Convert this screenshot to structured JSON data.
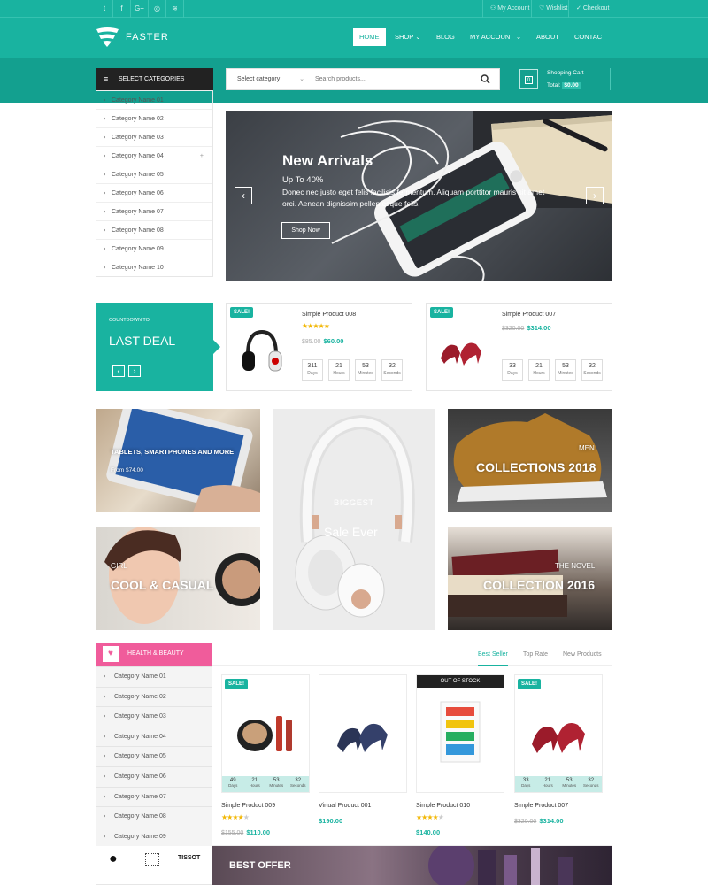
{
  "topbar": {
    "social": [
      "twitter-icon",
      "facebook-icon",
      "google-plus-icon",
      "instagram-icon",
      "rss-icon"
    ],
    "social_glyphs": [
      "t",
      "f",
      "G+",
      "◎",
      "≋"
    ],
    "my_account": "My Account",
    "wishlist": "Wishlist",
    "checkout": "Checkout"
  },
  "header": {
    "brand": "FASTER",
    "nav": [
      "HOME",
      "SHOP",
      "BLOG",
      "MY ACCOUNT",
      "ABOUT",
      "CONTACT"
    ]
  },
  "categories": {
    "title": "SELECT CATEGORIES",
    "items": [
      "Category Name 01",
      "Category Name 02",
      "Category Name 03",
      "Category Name 04",
      "Category Name 05",
      "Category Name 06",
      "Category Name 07",
      "Category Name 08",
      "Category Name 09",
      "Category Name 10"
    ]
  },
  "search": {
    "select": "Select category",
    "placeholder": "Search products..."
  },
  "cart": {
    "label": "Shopping Cart",
    "total_label": "Total:",
    "total": "$0.00",
    "count": "0"
  },
  "slider": {
    "title": "New Arrivals",
    "subtitle": "Up To 40%",
    "text": "Donec nec justo eget felis facilisis fermentum. Aliquam porttitor mauris sit amet orci. Aenean dignissim pellentesque felis.",
    "button": "Shop Now"
  },
  "deal": {
    "kicker": "COUNTDOWN TO",
    "title": "LAST DEAL",
    "products": [
      {
        "sale": "SALE!",
        "name": "Simple Product 008",
        "old": "$85.00",
        "price": "$60.00",
        "cd": [
          [
            "311",
            "Days"
          ],
          [
            "21",
            "Hours"
          ],
          [
            "53",
            "Minutes"
          ],
          [
            "32",
            "Seconds"
          ]
        ]
      },
      {
        "sale": "SALE!",
        "name": "Simple Product 007",
        "old": "$320.00",
        "price": "$314.00",
        "cd": [
          [
            "33",
            "Days"
          ],
          [
            "21",
            "Hours"
          ],
          [
            "53",
            "Minutes"
          ],
          [
            "32",
            "Seconds"
          ]
        ]
      }
    ]
  },
  "banners": {
    "tablet": "TABLETS, SMARTPHONES AND MORE",
    "tablet_sub": "From $74.00",
    "biggest": "BIGGEST",
    "sale_ever": "Sale Ever",
    "men": "MEN",
    "collections": "COLLECTIONS 2018",
    "girl": "GIRL",
    "cool": "COOL & CASUAL",
    "novel": "THE NOVEL",
    "collection2016": "COLLECTION 2016"
  },
  "health": {
    "title": "HEALTH & BEAUTY",
    "items": [
      "Category Name 01",
      "Category Name 02",
      "Category Name 03",
      "Category Name 04",
      "Category Name 05",
      "Category Name 06",
      "Category Name 07",
      "Category Name 08",
      "Category Name 09"
    ]
  },
  "tabs": [
    "Best Seller",
    "Top Rate",
    "New Products"
  ],
  "products": [
    {
      "badge": "SALE!",
      "name": "Simple Product 009",
      "old": "$155.00",
      "price": "$110.00",
      "rating": 4,
      "cd": [
        [
          "49",
          "Days"
        ],
        [
          "21",
          "Hours"
        ],
        [
          "53",
          "Minutes"
        ],
        [
          "32",
          "Seconds"
        ]
      ]
    },
    {
      "badge": "",
      "name": "Virtual Product 001",
      "old": "",
      "price": "$190.00",
      "rating": 0,
      "cd": []
    },
    {
      "badge": "OUT OF STOCK",
      "name": "Simple Product 010",
      "old": "",
      "price": "$140.00",
      "rating": 4,
      "cd": []
    },
    {
      "badge": "SALE!",
      "name": "Simple Product 007",
      "old": "$320.00",
      "price": "$314.00",
      "rating": 0,
      "cd": [
        [
          "33",
          "Days"
        ],
        [
          "21",
          "Hours"
        ],
        [
          "53",
          "Minutes"
        ],
        [
          "32",
          "Seconds"
        ]
      ]
    }
  ],
  "best_offer": "BEST OFFER",
  "brands": [
    "apple-logo",
    "nike-logo",
    "tissot-logo"
  ],
  "brand_tissot": "TISSOT"
}
